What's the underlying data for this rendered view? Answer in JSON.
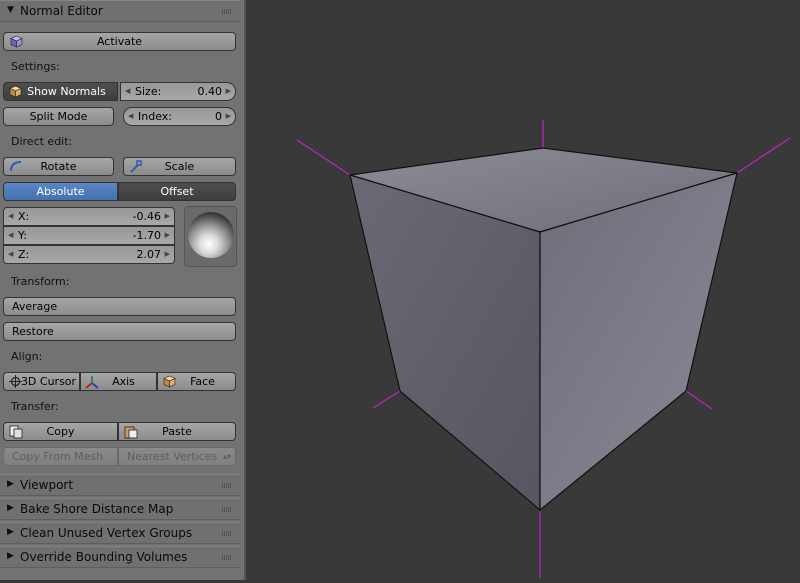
{
  "panel": {
    "header": "Normal Editor",
    "activate_label": "Activate",
    "settings_label": "Settings:",
    "show_normals_label": "Show Normals",
    "size_label": "Size:",
    "size_value": "0.40",
    "split_mode_label": "Split Mode",
    "index_label": "Index:",
    "index_value": "0",
    "direct_edit_label": "Direct edit:",
    "rotate_label": "Rotate",
    "scale_label": "Scale",
    "absolute_label": "Absolute",
    "offset_label": "Offset",
    "x_label": "X:",
    "x_value": "-0.46",
    "y_label": "Y:",
    "y_value": "-1.70",
    "z_label": "Z:",
    "z_value": "2.07",
    "transform_label": "Transform:",
    "average_label": "Average",
    "restore_label": "Restore",
    "align_label": "Align:",
    "cursor_label": "3D Cursor",
    "axis_label": "Axis",
    "face_label": "Face",
    "transfer_label": "Transfer:",
    "copy_label": "Copy",
    "paste_label": "Paste",
    "copy_from_mesh_label": "Copy From Mesh",
    "nearest_vertices_label": "Nearest Vertices"
  },
  "collapsed_panels": [
    "Viewport",
    "Bake Shore Distance Map",
    "Clean Unused Vertex Groups",
    "Override Bounding Volumes"
  ],
  "colors": {
    "panel_bg": "#727272",
    "viewport_bg": "#393939",
    "selected_blue": "#4f7cc0",
    "normal_line": "#e020e0"
  },
  "icons": {
    "activate": "cube-icon",
    "show_normals": "box-icon",
    "rotate": "rotate-icon",
    "scale": "scale-icon",
    "cursor": "crosshair-icon",
    "axis": "axis-icon",
    "face": "face-icon",
    "copy": "copy-icon",
    "paste": "paste-icon"
  }
}
